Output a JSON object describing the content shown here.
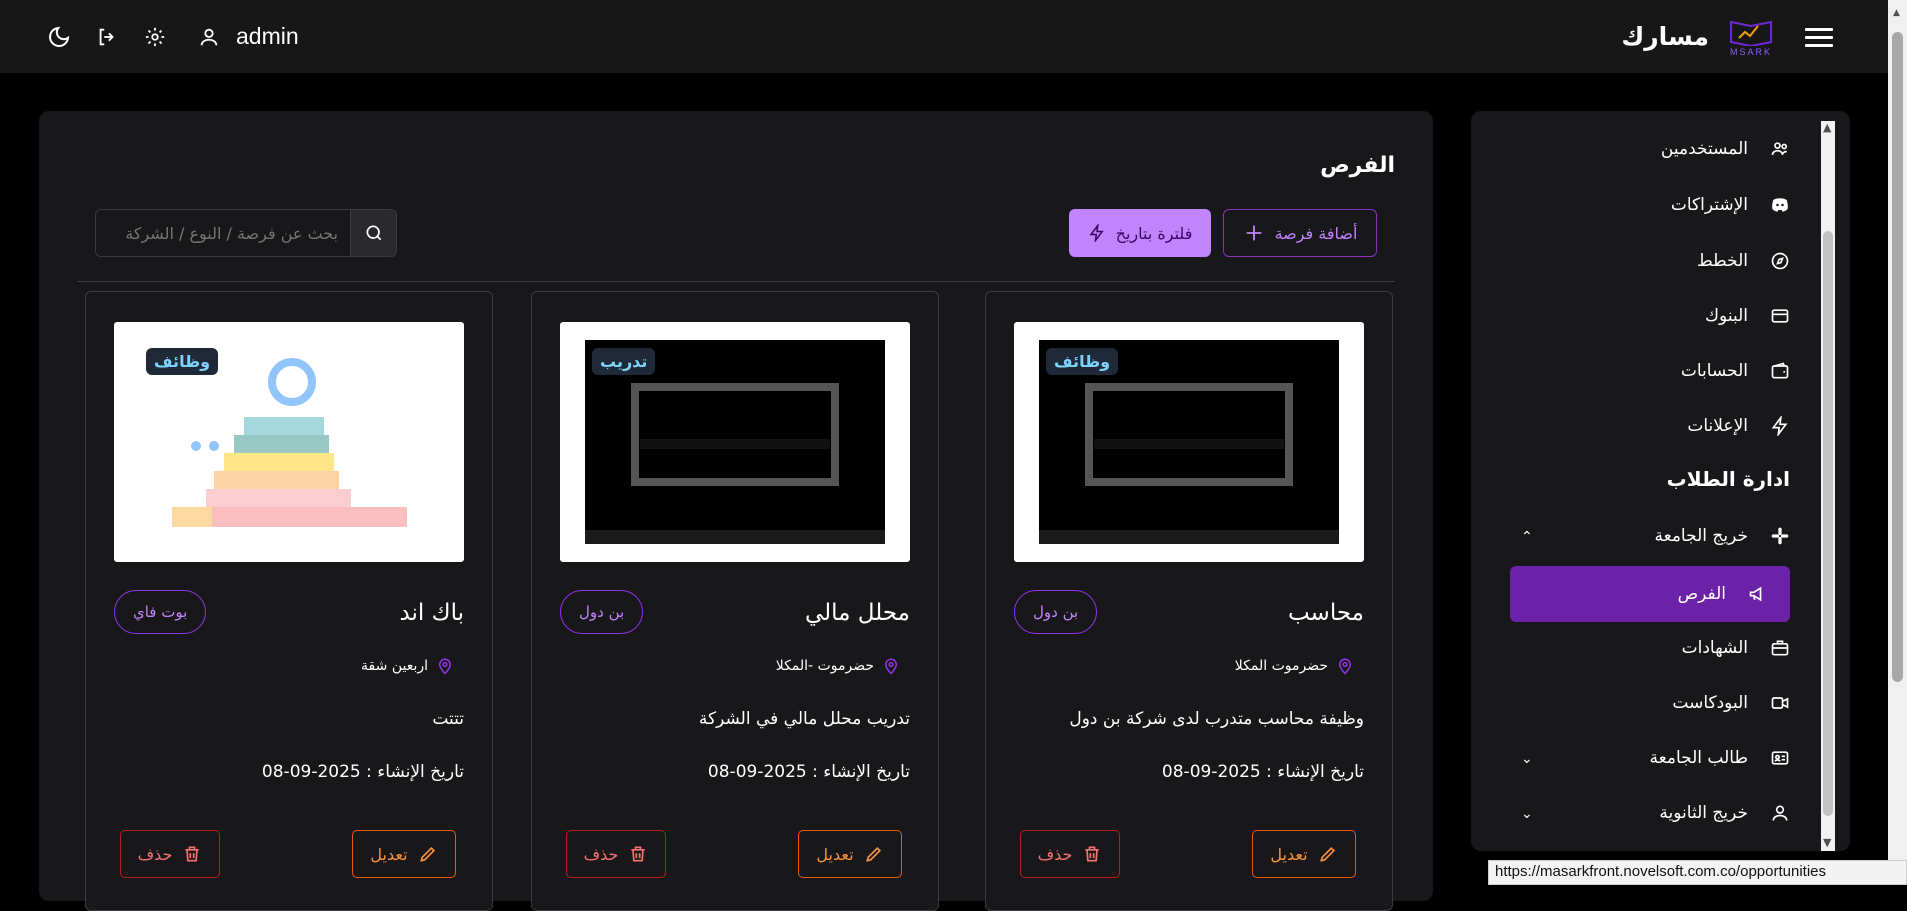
{
  "header": {
    "username": "admin",
    "brand_name": "مسارك",
    "logo_caption": "MSARK"
  },
  "main": {
    "title": "الفرص",
    "search_placeholder": "بحث عن فرصة / النوع / الشركة",
    "add_label": "أضافة فرصة",
    "filter_label": "فلترة بتاريخ",
    "cards": [
      {
        "type": "وظائف",
        "title": "محاسب",
        "company": "بن دول",
        "location": "حضرموت المكلا",
        "desc": "وظيفة محاسب متدرب لدى شركة بن دول",
        "date": "تاريخ الإنشاء : 2025-09-08",
        "edit": "تعديل",
        "del": "حذف"
      },
      {
        "type": "تدريب",
        "title": "محلل مالي",
        "company": "بن دول",
        "location": "حضرموت -المكلا",
        "desc": "تدريب محلل مالي في الشركة",
        "date": "تاريخ الإنشاء : 2025-09-08",
        "edit": "تعديل",
        "del": "حذف"
      },
      {
        "type": "وظائف",
        "title": "باك اند",
        "company": "بوت فاي",
        "location": "اربعين شقة",
        "desc": "تتتت",
        "date": "تاريخ الإنشاء : 2025-09-08",
        "edit": "تعديل",
        "del": "حذف"
      }
    ]
  },
  "sidebar": {
    "items": [
      {
        "label": "المستخدمين"
      },
      {
        "label": "الإشتراكات"
      },
      {
        "label": "الخطط"
      },
      {
        "label": "البنوك"
      },
      {
        "label": "الحسابات"
      },
      {
        "label": "الإعلانات"
      }
    ],
    "section_title": "ادارة الطلاب",
    "group_label": "خريج الجامعة",
    "sub_items": [
      {
        "label": "الفرص"
      },
      {
        "label": "الشهادات"
      },
      {
        "label": "البودكاست"
      }
    ],
    "more_groups": [
      {
        "label": "طالب الجامعة"
      },
      {
        "label": "خريج الثانوية"
      }
    ]
  },
  "status_url": "https://masarkfront.novelsoft.com.co/opportunities",
  "colors": {
    "accent": "#6b21a8",
    "accent_light": "#c084fc",
    "edit": "#ea580c",
    "delete": "#b91c1c"
  }
}
